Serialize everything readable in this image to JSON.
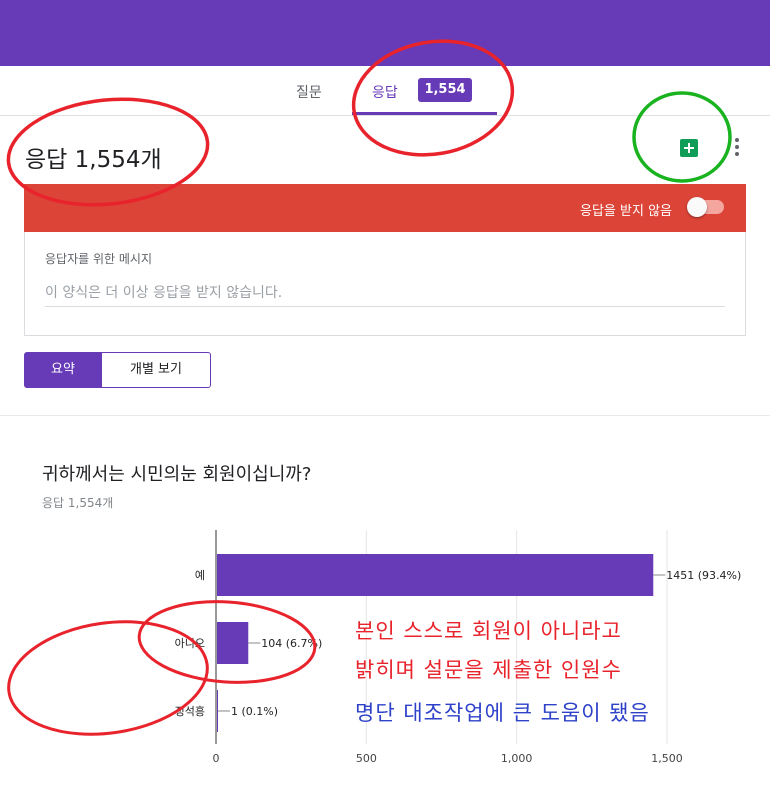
{
  "header": {
    "color": "#673ab7"
  },
  "tabs": {
    "questions": "질문",
    "responses": "응답",
    "responses_badge": "1,554"
  },
  "responses": {
    "title": "응답 1,554개",
    "accepting_label": "응답을 받지 않음",
    "accepting": false,
    "message_label": "응답자를 위한 메시지",
    "message_text": "이 양식은 더 이상 응답을 받지 않습니다."
  },
  "view_toggle": {
    "summary": "요약",
    "individual": "개별 보기"
  },
  "question": {
    "title": "귀하께서는 시민의눈 회원이십니까?",
    "count": "응답 1,554개"
  },
  "chart_data": {
    "type": "bar",
    "orientation": "horizontal",
    "categories": [
      "예",
      "아니오",
      "정석흥"
    ],
    "values": [
      1451,
      104,
      1
    ],
    "data_labels": [
      "1451 (93.4%)",
      "104 (6.7%)",
      "1 (0.1%)"
    ],
    "xlim": [
      0,
      1500
    ],
    "xticks": [
      "0",
      "500",
      "1,000",
      "1,500"
    ],
    "xtick_values": [
      0,
      500,
      1000,
      1500
    ],
    "grid": true,
    "bar_color": "#673ab7"
  },
  "annotations": {
    "line1": "본인 스스로 회원이 아니라고",
    "line2": "밝히며 설문을 제출한 인원수",
    "line3": "명단 대조작업에 큰 도움이 됐음"
  }
}
